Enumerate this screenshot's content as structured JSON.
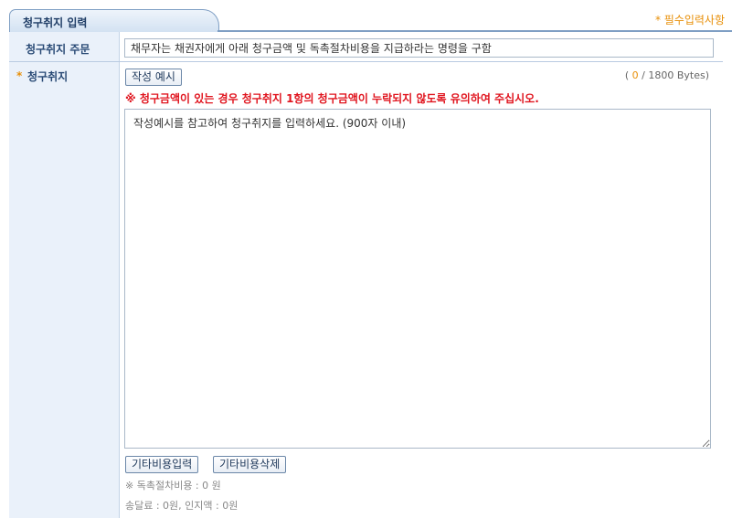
{
  "header": {
    "title": "청구취지 입력",
    "required_note": "* 필수입력사항"
  },
  "labels": {
    "summary": "청구취지 주문",
    "star": "*",
    "claim": "청구취지"
  },
  "summary_field": {
    "value": "채무자는 채권자에게 아래 청구금액 및 독촉절차비용을 지급하라는 명령을 구함"
  },
  "claim": {
    "example_button": "작성 예시",
    "bytes_open": "( ",
    "bytes_count": "0",
    "bytes_rest": " / 1800 Bytes)",
    "warning": "※ 청구금액이 있는 경우 청구취지 1항의 청구금액이 누락되지 않도록 유의하여 주십시오.",
    "textarea_placeholder": "작성예시를 참고하여 청구취지를 입력하세요. (900자 이내)",
    "add_cost_button": "기타비용입력",
    "delete_cost_button": "기타비용삭제",
    "fee_note": "※ 독촉절차비용 : 0 원",
    "detail_note": "송달료 : 0원, 인지액 : 0원"
  },
  "colors": {
    "accent": "#e8900a",
    "warning": "#e0141e",
    "label_bg": "#eaf1fa",
    "border": "#7f9fc4"
  }
}
